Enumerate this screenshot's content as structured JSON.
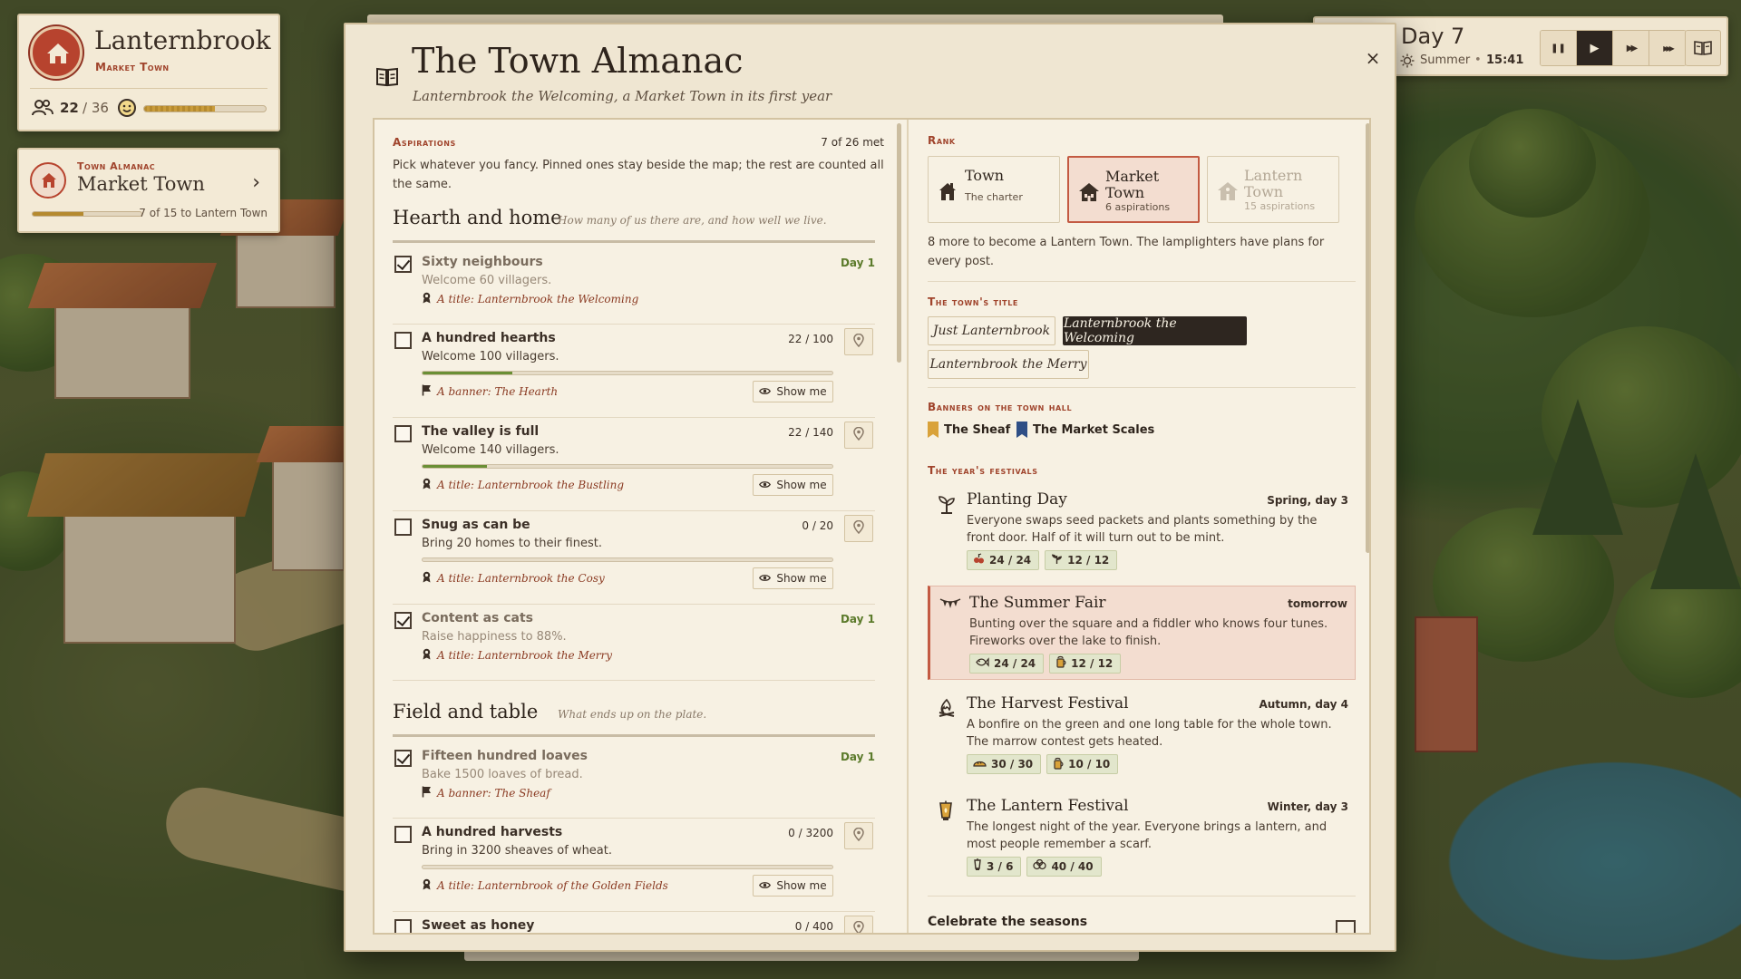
{
  "hud": {
    "town_name": "Lanternbrook",
    "town_rank": "Market Town",
    "population": "22",
    "population_max": "/ 36",
    "happiness_fraction": 0.58,
    "almanac_kicker": "Town Almanac",
    "almanac_rank": "Market Town",
    "almanac_progress_text": "7 of 15 to Lantern Town",
    "almanac_progress_fraction": 0.47,
    "day_label": "Day",
    "day_number": "7",
    "season": "Summer",
    "season_sep": "•",
    "clock": "15:41",
    "speed_buttons": [
      {
        "icon": "pause-icon",
        "glyph": "❚❚",
        "active": false
      },
      {
        "icon": "play-icon",
        "glyph": "▶",
        "active": true
      },
      {
        "icon": "fast-forward-icon",
        "glyph": "▶▶",
        "active": false
      },
      {
        "icon": "fastest-forward-icon",
        "glyph": "▶▶▶",
        "active": false
      }
    ]
  },
  "almanac": {
    "title": "The Town Almanac",
    "subtitle": "Lanternbrook the Welcoming, a Market Town in its first year",
    "close_label": "×",
    "aspirations": {
      "kicker": "Aspirations",
      "met": "7 of 26 met",
      "hint": "Pick whatever you fancy. Pinned ones stay beside the map; the rest are counted all the same.",
      "show_me_label": "Show me",
      "sections": [
        {
          "name": "Hearth and home",
          "desc": "How many of us there are, and how well we live.",
          "items": [
            {
              "title": "Sixty neighbours",
              "sub": "Welcome 60 villagers.",
              "status": "Day 1",
              "done": true,
              "reward_type": "title",
              "reward": "A title: Lanternbrook the Welcoming"
            },
            {
              "title": "A hundred hearths",
              "sub": "Welcome 100 villagers.",
              "status": "22 / 100",
              "done": false,
              "progress": 0.22,
              "reward_type": "banner",
              "reward": "A banner: The Hearth"
            },
            {
              "title": "The valley is full",
              "sub": "Welcome 140 villagers.",
              "status": "22 / 140",
              "done": false,
              "progress": 0.157,
              "reward_type": "title",
              "reward": "A title: Lanternbrook the Bustling"
            },
            {
              "title": "Snug as can be",
              "sub": "Bring 20 homes to their finest.",
              "status": "0 / 20",
              "done": false,
              "progress": 0,
              "reward_type": "title",
              "reward": "A title: Lanternbrook the Cosy"
            },
            {
              "title": "Content as cats",
              "sub": "Raise happiness to 88%.",
              "status": "Day 1",
              "done": true,
              "reward_type": "title",
              "reward": "A title: Lanternbrook the Merry"
            }
          ]
        },
        {
          "name": "Field and table",
          "desc": "What ends up on the plate.",
          "items": [
            {
              "title": "Fifteen hundred loaves",
              "sub": "Bake 1500 loaves of bread.",
              "status": "Day 1",
              "done": true,
              "reward_type": "banner",
              "reward": "A banner: The Sheaf"
            },
            {
              "title": "A hundred harvests",
              "sub": "Bring in 3200 sheaves of wheat.",
              "status": "0 / 3200",
              "done": false,
              "progress": 0,
              "reward_type": "title",
              "reward": "A title: Lanternbrook of the Golden Fields"
            },
            {
              "title": "Sweet as honey",
              "sub": "",
              "status": "0 / 400",
              "done": false,
              "progress": 0
            }
          ]
        }
      ]
    },
    "rank": {
      "kicker": "Rank",
      "tiers": [
        {
          "name": "Town",
          "sub": "The charter",
          "state": "past"
        },
        {
          "name": "Market Town",
          "sub": "6 aspirations",
          "state": "current"
        },
        {
          "name": "Lantern Town",
          "sub": "15 aspirations",
          "state": "locked"
        }
      ],
      "next": "8 more to become a Lantern Town. The lamplighters have plans for every post."
    },
    "town_title": {
      "kicker": "The town's title",
      "options": [
        {
          "label": "Just Lanternbrook",
          "selected": false
        },
        {
          "label": "Lanternbrook the Welcoming",
          "selected": true
        },
        {
          "label": "Lanternbrook the Merry",
          "selected": false
        }
      ]
    },
    "banners": {
      "kicker": "Banners on the town hall",
      "items": [
        {
          "name": "The Sheaf",
          "color": "#d9a23a"
        },
        {
          "name": "The Market Scales",
          "color": "#2f4f86"
        }
      ]
    },
    "festivals": {
      "kicker": "The year's festivals",
      "items": [
        {
          "name": "Planting Day",
          "when": "Spring, day 3",
          "desc": "Everyone swaps seed packets and plants something by the front door. Half of it will turn out to be mint.",
          "icon": "sprout-icon",
          "soon": false,
          "reqs": [
            {
              "icon": "berries-icon",
              "text": "24 / 24"
            },
            {
              "icon": "herb-icon",
              "text": "12 / 12"
            }
          ]
        },
        {
          "name": "The Summer Fair",
          "when": "tomorrow",
          "desc": "Bunting over the square and a fiddler who knows four tunes. Fireworks over the lake to finish.",
          "icon": "bunting-icon",
          "soon": true,
          "reqs": [
            {
              "icon": "fish-icon",
              "text": "24 / 24"
            },
            {
              "icon": "cider-icon",
              "text": "12 / 12"
            }
          ]
        },
        {
          "name": "The Harvest Festival",
          "when": "Autumn, day 4",
          "desc": "A bonfire on the green and one long table for the whole town. The marrow contest gets heated.",
          "icon": "bonfire-icon",
          "soon": false,
          "reqs": [
            {
              "icon": "bread-icon",
              "text": "30 / 30"
            },
            {
              "icon": "cider-icon",
              "text": "10 / 10"
            }
          ]
        },
        {
          "name": "The Lantern Festival",
          "when": "Winter, day 3",
          "desc": "The longest night of the year. Everyone brings a lantern, and most people remember a scarf.",
          "icon": "lantern-icon",
          "soon": false,
          "reqs": [
            {
              "icon": "lantern-small-icon",
              "text": "3 / 6"
            },
            {
              "icon": "wool-icon",
              "text": "40 / 40"
            }
          ]
        }
      ]
    },
    "celebrate_label": "Celebrate the seasons"
  }
}
